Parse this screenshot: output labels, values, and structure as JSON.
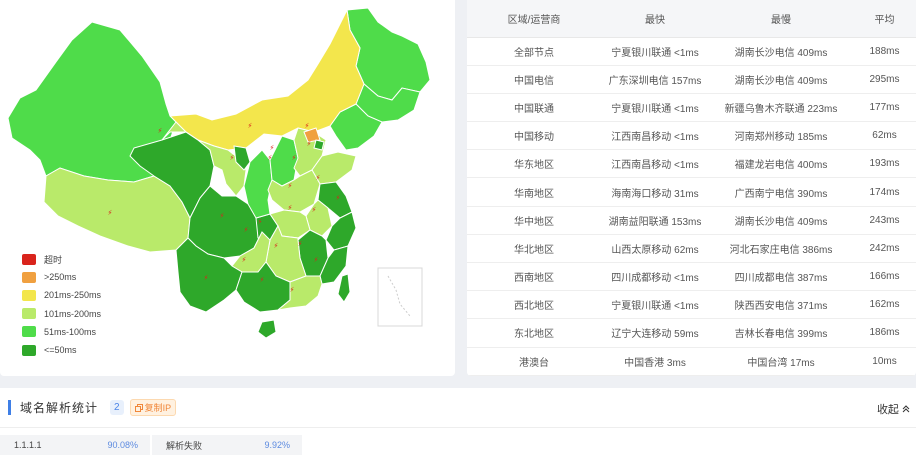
{
  "map": {
    "marker_symbol": "⚡",
    "legend": [
      {
        "label": "超时",
        "color": "#d9241c"
      },
      {
        "label": ">250ms",
        "color": "#f0a040"
      },
      {
        "label": "201ms-250ms",
        "color": "#f3e64c"
      },
      {
        "label": "101ms-200ms",
        "color": "#b9ea6a"
      },
      {
        "label": "51ms-100ms",
        "color": "#4fdc4a"
      },
      {
        "label": "<=50ms",
        "color": "#2ea82a"
      }
    ]
  },
  "table": {
    "headers": [
      "区域/运营商",
      "最快",
      "最慢",
      "平均"
    ],
    "rows": [
      [
        "全部节点",
        "宁夏银川联通 <1ms",
        "湖南长沙电信 409ms",
        "188ms"
      ],
      [
        "中国电信",
        "广东深圳电信 157ms",
        "湖南长沙电信 409ms",
        "295ms"
      ],
      [
        "中国联通",
        "宁夏银川联通 <1ms",
        "新疆乌鲁木齐联通 223ms",
        "177ms"
      ],
      [
        "中国移动",
        "江西南昌移动 <1ms",
        "河南郑州移动 185ms",
        "62ms"
      ],
      [
        "华东地区",
        "江西南昌移动 <1ms",
        "福建龙岩电信 400ms",
        "193ms"
      ],
      [
        "华南地区",
        "海南海口移动 31ms",
        "广西南宁电信 390ms",
        "174ms"
      ],
      [
        "华中地区",
        "湖南益阳联通 153ms",
        "湖南长沙电信 409ms",
        "243ms"
      ],
      [
        "华北地区",
        "山西太原移动 62ms",
        "河北石家庄电信 386ms",
        "242ms"
      ],
      [
        "西南地区",
        "四川成都移动 <1ms",
        "四川成都电信 387ms",
        "166ms"
      ],
      [
        "西北地区",
        "宁夏银川联通 <1ms",
        "陕西西安电信 371ms",
        "162ms"
      ],
      [
        "东北地区",
        "辽宁大连移动 59ms",
        "吉林长春电信 399ms",
        "186ms"
      ],
      [
        "港澳台",
        "中国香港 3ms",
        "中国台湾 17ms",
        "10ms"
      ]
    ]
  },
  "dns": {
    "title": "域名解析统计",
    "count": "2",
    "copy_label": "复制IP",
    "collapse_label": "收起",
    "results": [
      {
        "label": "1.1.1.1",
        "percent": "90.08%"
      },
      {
        "label": "解析失败",
        "percent": "9.92%"
      }
    ]
  }
}
